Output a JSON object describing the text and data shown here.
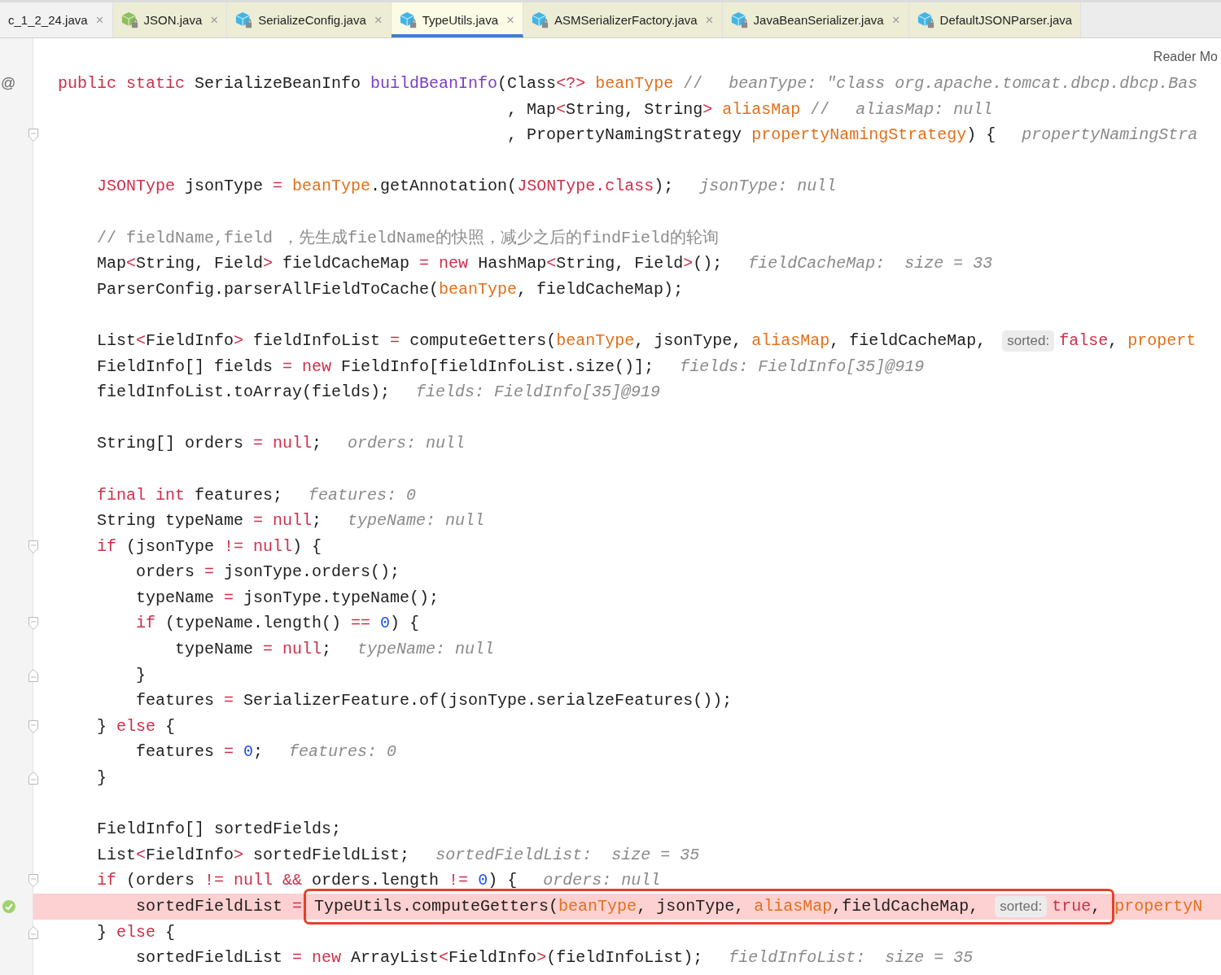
{
  "tabs": [
    {
      "label": "c_1_2_24.java",
      "close": "×",
      "selected": false,
      "library": false
    },
    {
      "label": "JSON.java",
      "close": "×",
      "selected": false,
      "library": true,
      "color": "#8dbf5a"
    },
    {
      "label": "SerializeConfig.java",
      "close": "×",
      "selected": false,
      "library": true,
      "color": "#40b6e8"
    },
    {
      "label": "TypeUtils.java",
      "close": "×",
      "selected": true,
      "library": true,
      "color": "#40b6e8"
    },
    {
      "label": "ASMSerializerFactory.java",
      "close": "×",
      "selected": false,
      "library": true,
      "color": "#40b6e8"
    },
    {
      "label": "JavaBeanSerializer.java",
      "close": "×",
      "selected": false,
      "library": true,
      "color": "#40b6e8"
    },
    {
      "label": "DefaultJSONParser.java",
      "selected": false,
      "library": true,
      "color": "#40b6e8"
    }
  ],
  "reader_mode": "Reader Mo",
  "lines": [
    {
      "kind": "code",
      "highlighted": false,
      "marker": {
        "kind": "text",
        "text": "@"
      },
      "segments": [
        {
          "kind": "code",
          "tokens": [
            {
              "kind": "kw",
              "text": "public static"
            },
            {
              "kind": "p",
              "text": " SerializeBeanInfo "
            },
            {
              "kind": "fn",
              "text": "buildBeanInfo"
            },
            {
              "kind": "p",
              "text": "(Class"
            },
            {
              "kind": "kw",
              "text": "<?>"
            },
            {
              "kind": "param",
              "text": " beanType"
            },
            {
              "kind": "cm",
              "text": " //"
            }
          ]
        },
        {
          "kind": "debug",
          "text": "beanType: \"class org.apache.tomcat.dbcp.dbcp.Bas"
        }
      ]
    },
    {
      "kind": "continuation",
      "highlighted": false,
      "segments": [
        {
          "kind": "code",
          "tokens": [
            {
              "kind": "p",
              "text": ", Map"
            },
            {
              "kind": "kw",
              "text": "<"
            },
            {
              "kind": "p",
              "text": "String, String"
            },
            {
              "kind": "kw",
              "text": ">"
            },
            {
              "kind": "param",
              "text": " aliasMap"
            },
            {
              "kind": "cm",
              "text": " //"
            }
          ]
        },
        {
          "kind": "debug",
          "text": "aliasMap: null"
        }
      ]
    },
    {
      "kind": "continuation",
      "highlighted": false,
      "marker": {
        "kind": "fold-start"
      },
      "segments": [
        {
          "kind": "code",
          "tokens": [
            {
              "kind": "p",
              "text": ", PropertyNamingStrategy "
            },
            {
              "kind": "param",
              "text": "propertyNamingStrategy"
            },
            {
              "kind": "p",
              "text": ") {"
            }
          ]
        },
        {
          "kind": "debug",
          "text": "propertyNamingStra"
        }
      ],
      "children": [
        {
          "kind": "blank",
          "highlighted": false
        },
        {
          "kind": "code",
          "highlighted": false,
          "segments": [
            {
              "kind": "code",
              "tokens": [
                {
                  "kind": "kw",
                  "text": "JSONType"
                },
                {
                  "kind": "p",
                  "text": " jsonType "
                },
                {
                  "kind": "kw",
                  "text": "="
                },
                {
                  "kind": "param",
                  "text": " beanType"
                },
                {
                  "kind": "p",
                  "text": ".getAnnotation("
                },
                {
                  "kind": "kw",
                  "text": "JSONType.class"
                },
                {
                  "kind": "p",
                  "text": ");"
                }
              ]
            },
            {
              "kind": "debug",
              "text": "jsonType: null"
            }
          ]
        },
        {
          "kind": "blank",
          "highlighted": false
        },
        {
          "kind": "code",
          "highlighted": false,
          "segments": [
            {
              "kind": "code",
              "tokens": [
                {
                  "kind": "cm",
                  "text": "// fieldName,field ，先生成fieldName的快照，减少之后的findField的轮询"
                }
              ]
            }
          ]
        },
        {
          "kind": "code",
          "highlighted": false,
          "segments": [
            {
              "kind": "code",
              "tokens": [
                {
                  "kind": "p",
                  "text": "Map"
                },
                {
                  "kind": "kw",
                  "text": "<"
                },
                {
                  "kind": "p",
                  "text": "String, Field"
                },
                {
                  "kind": "kw",
                  "text": ">"
                },
                {
                  "kind": "p",
                  "text": " fieldCacheMap "
                },
                {
                  "kind": "kw",
                  "text": "= new"
                },
                {
                  "kind": "p",
                  "text": " HashMap"
                },
                {
                  "kind": "kw",
                  "text": "<"
                },
                {
                  "kind": "p",
                  "text": "String, Field"
                },
                {
                  "kind": "kw",
                  "text": ">"
                },
                {
                  "kind": "p",
                  "text": "();"
                }
              ]
            },
            {
              "kind": "debug",
              "text": "fieldCacheMap:  size = 33"
            }
          ]
        },
        {
          "kind": "code",
          "highlighted": false,
          "segments": [
            {
              "kind": "code",
              "tokens": [
                {
                  "kind": "p",
                  "text": "ParserConfig.parserAllFieldToCache("
                },
                {
                  "kind": "param",
                  "text": "beanType"
                },
                {
                  "kind": "p",
                  "text": ", fieldCacheMap);"
                }
              ]
            }
          ]
        },
        {
          "kind": "blank",
          "highlighted": false
        },
        {
          "kind": "code",
          "highlighted": false,
          "segments": [
            {
              "kind": "code",
              "tokens": [
                {
                  "kind": "p",
                  "text": "List"
                },
                {
                  "kind": "kw",
                  "text": "<"
                },
                {
                  "kind": "p",
                  "text": "FieldInfo"
                },
                {
                  "kind": "kw",
                  "text": ">"
                },
                {
                  "kind": "p",
                  "text": " fieldInfoList "
                },
                {
                  "kind": "kw",
                  "text": "="
                },
                {
                  "kind": "p",
                  "text": " computeGetters("
                },
                {
                  "kind": "param",
                  "text": "beanType"
                },
                {
                  "kind": "p",
                  "text": ", jsonType, "
                },
                {
                  "kind": "param",
                  "text": "aliasMap"
                },
                {
                  "kind": "p",
                  "text": ", fieldCacheMap,"
                }
              ]
            },
            {
              "kind": "inlay",
              "text": "sorted:"
            },
            {
              "kind": "code",
              "tokens": [
                {
                  "kind": "kw",
                  "text": "false"
                },
                {
                  "kind": "p",
                  "text": ", "
                },
                {
                  "kind": "param",
                  "text": "propert"
                }
              ]
            }
          ]
        },
        {
          "kind": "code",
          "highlighted": false,
          "segments": [
            {
              "kind": "code",
              "tokens": [
                {
                  "kind": "p",
                  "text": "FieldInfo[] fields "
                },
                {
                  "kind": "kw",
                  "text": "= new"
                },
                {
                  "kind": "p",
                  "text": " FieldInfo[fieldInfoList.size()];"
                }
              ]
            },
            {
              "kind": "debug",
              "text": "fields: FieldInfo[35]@919"
            }
          ]
        },
        {
          "kind": "code",
          "highlighted": false,
          "segments": [
            {
              "kind": "code",
              "tokens": [
                {
                  "kind": "p",
                  "text": "fieldInfoList.toArray(fields);"
                }
              ]
            },
            {
              "kind": "debug",
              "text": "fields: FieldInfo[35]@919"
            }
          ]
        },
        {
          "kind": "blank",
          "highlighted": false
        },
        {
          "kind": "code",
          "highlighted": false,
          "segments": [
            {
              "kind": "code",
              "tokens": [
                {
                  "kind": "p",
                  "text": "String[] orders "
                },
                {
                  "kind": "kw",
                  "text": "= null"
                },
                {
                  "kind": "p",
                  "text": ";"
                }
              ]
            },
            {
              "kind": "debug",
              "text": "orders: null"
            }
          ]
        },
        {
          "kind": "blank",
          "highlighted": false
        },
        {
          "kind": "code",
          "highlighted": false,
          "segments": [
            {
              "kind": "code",
              "tokens": [
                {
                  "kind": "kw",
                  "text": "final int"
                },
                {
                  "kind": "p",
                  "text": " features;"
                }
              ]
            },
            {
              "kind": "debug",
              "text": "features: 0"
            }
          ]
        },
        {
          "kind": "code",
          "highlighted": false,
          "segments": [
            {
              "kind": "code",
              "tokens": [
                {
                  "kind": "p",
                  "text": "String typeName "
                },
                {
                  "kind": "kw",
                  "text": "= null"
                },
                {
                  "kind": "p",
                  "text": ";"
                }
              ]
            },
            {
              "kind": "debug",
              "text": "typeName: null"
            }
          ]
        },
        {
          "kind": "code",
          "highlighted": false,
          "marker": {
            "kind": "fold-start"
          },
          "segments": [
            {
              "kind": "code",
              "tokens": [
                {
                  "kind": "kw",
                  "text": "if"
                },
                {
                  "kind": "p",
                  "text": " (jsonType "
                },
                {
                  "kind": "kw",
                  "text": "!= null"
                },
                {
                  "kind": "p",
                  "text": ") {"
                }
              ]
            }
          ],
          "children": [
            {
              "kind": "code",
              "highlighted": false,
              "segments": [
                {
                  "kind": "code",
                  "tokens": [
                    {
                      "kind": "p",
                      "text": "orders "
                    },
                    {
                      "kind": "kw",
                      "text": "="
                    },
                    {
                      "kind": "p",
                      "text": " jsonType.orders();"
                    }
                  ]
                }
              ]
            },
            {
              "kind": "code",
              "highlighted": false,
              "segments": [
                {
                  "kind": "code",
                  "tokens": [
                    {
                      "kind": "p",
                      "text": "typeName "
                    },
                    {
                      "kind": "kw",
                      "text": "="
                    },
                    {
                      "kind": "p",
                      "text": " jsonType.typeName();"
                    }
                  ]
                }
              ]
            },
            {
              "kind": "code",
              "highlighted": false,
              "marker": {
                "kind": "fold-start"
              },
              "segments": [
                {
                  "kind": "code",
                  "tokens": [
                    {
                      "kind": "kw",
                      "text": "if"
                    },
                    {
                      "kind": "p",
                      "text": " (typeName.length() "
                    },
                    {
                      "kind": "kw",
                      "text": "=="
                    },
                    {
                      "kind": "num",
                      "text": " 0"
                    },
                    {
                      "kind": "p",
                      "text": ") {"
                    }
                  ]
                }
              ],
              "children": [
                {
                  "kind": "code",
                  "highlighted": false,
                  "segments": [
                    {
                      "kind": "code",
                      "tokens": [
                        {
                          "kind": "p",
                          "text": "typeName "
                        },
                        {
                          "kind": "kw",
                          "text": "= null"
                        },
                        {
                          "kind": "p",
                          "text": ";"
                        }
                      ]
                    },
                    {
                      "kind": "debug",
                      "text": "typeName: null"
                    }
                  ]
                }
              ]
            },
            {
              "kind": "code",
              "highlighted": false,
              "marker": {
                "kind": "fold-end"
              },
              "segments": [
                {
                  "kind": "code",
                  "tokens": [
                    {
                      "kind": "p",
                      "text": "}"
                    }
                  ]
                }
              ]
            },
            {
              "kind": "code",
              "highlighted": false,
              "segments": [
                {
                  "kind": "code",
                  "tokens": [
                    {
                      "kind": "p",
                      "text": "features "
                    },
                    {
                      "kind": "kw",
                      "text": "="
                    },
                    {
                      "kind": "p",
                      "text": " SerializerFeature.of(jsonType.serialzeFeatures());"
                    }
                  ]
                }
              ]
            }
          ]
        },
        {
          "kind": "code",
          "highlighted": false,
          "marker": {
            "kind": "fold-start"
          },
          "segments": [
            {
              "kind": "code",
              "tokens": [
                {
                  "kind": "p",
                  "text": "} "
                },
                {
                  "kind": "kw",
                  "text": "else"
                },
                {
                  "kind": "p",
                  "text": " {"
                }
              ]
            }
          ],
          "children": [
            {
              "kind": "code",
              "highlighted": false,
              "segments": [
                {
                  "kind": "code",
                  "tokens": [
                    {
                      "kind": "p",
                      "text": "features "
                    },
                    {
                      "kind": "kw",
                      "text": "="
                    },
                    {
                      "kind": "num",
                      "text": " 0"
                    },
                    {
                      "kind": "p",
                      "text": ";"
                    }
                  ]
                },
                {
                  "kind": "debug",
                  "text": "features: 0"
                }
              ]
            }
          ]
        },
        {
          "kind": "code",
          "highlighted": false,
          "marker": {
            "kind": "fold-end"
          },
          "segments": [
            {
              "kind": "code",
              "tokens": [
                {
                  "kind": "p",
                  "text": "}"
                }
              ]
            }
          ]
        },
        {
          "kind": "blank",
          "highlighted": false
        },
        {
          "kind": "code",
          "highlighted": false,
          "segments": [
            {
              "kind": "code",
              "tokens": [
                {
                  "kind": "p",
                  "text": "FieldInfo[] sortedFields;"
                }
              ]
            }
          ]
        },
        {
          "kind": "code",
          "highlighted": false,
          "segments": [
            {
              "kind": "code",
              "tokens": [
                {
                  "kind": "p",
                  "text": "List"
                },
                {
                  "kind": "kw",
                  "text": "<"
                },
                {
                  "kind": "p",
                  "text": "FieldInfo"
                },
                {
                  "kind": "kw",
                  "text": ">"
                },
                {
                  "kind": "p",
                  "text": " sortedFieldList;"
                }
              ]
            },
            {
              "kind": "debug",
              "text": "sortedFieldList:  size = 35"
            }
          ]
        },
        {
          "kind": "code",
          "highlighted": false,
          "marker": {
            "kind": "fold-start"
          },
          "segments": [
            {
              "kind": "code",
              "tokens": [
                {
                  "kind": "kw",
                  "text": "if"
                },
                {
                  "kind": "p",
                  "text": " (orders "
                },
                {
                  "kind": "kw",
                  "text": "!= null &&"
                },
                {
                  "kind": "p",
                  "text": " orders.length "
                },
                {
                  "kind": "kw",
                  "text": "!="
                },
                {
                  "kind": "num",
                  "text": " 0"
                },
                {
                  "kind": "p",
                  "text": ") {"
                }
              ]
            },
            {
              "kind": "debug",
              "text": "orders: null"
            }
          ],
          "children": [
            {
              "kind": "code",
              "highlighted": true,
              "marker": {
                "kind": "ok"
              },
              "segments": [
                {
                  "kind": "code",
                  "tokens": [
                    {
                      "kind": "p",
                      "text": "sortedFieldList "
                    },
                    {
                      "kind": "kw",
                      "text": "="
                    }
                  ]
                },
                {
                  "kind": "frame",
                  "segments": [
                    {
                      "kind": "code",
                      "tokens": [
                        {
                          "kind": "p",
                          "text": "TypeUtils.computeGetters("
                        },
                        {
                          "kind": "param",
                          "text": "beanType"
                        },
                        {
                          "kind": "p",
                          "text": ", jsonType, "
                        },
                        {
                          "kind": "param",
                          "text": "aliasMap"
                        },
                        {
                          "kind": "p",
                          "text": ",fieldCacheMap,"
                        }
                      ]
                    },
                    {
                      "kind": "inlay",
                      "text": "sorted:"
                    },
                    {
                      "kind": "code",
                      "tokens": [
                        {
                          "kind": "kw",
                          "text": "true"
                        },
                        {
                          "kind": "p",
                          "text": ","
                        }
                      ]
                    }
                  ]
                },
                {
                  "kind": "code",
                  "tokens": [
                    {
                      "kind": "param",
                      "text": "propertyN"
                    }
                  ]
                }
              ]
            }
          ]
        },
        {
          "kind": "code",
          "highlighted": false,
          "marker": {
            "kind": "fold-end"
          },
          "segments": [
            {
              "kind": "code",
              "tokens": [
                {
                  "kind": "p",
                  "text": "} "
                },
                {
                  "kind": "kw",
                  "text": "else"
                },
                {
                  "kind": "p",
                  "text": " {"
                }
              ]
            }
          ],
          "children": [
            {
              "kind": "code",
              "highlighted": false,
              "segments": [
                {
                  "kind": "code",
                  "tokens": [
                    {
                      "kind": "p",
                      "text": "sortedFieldList "
                    },
                    {
                      "kind": "kw",
                      "text": "= new"
                    },
                    {
                      "kind": "p",
                      "text": " ArrayList"
                    },
                    {
                      "kind": "kw",
                      "text": "<"
                    },
                    {
                      "kind": "p",
                      "text": "FieldInfo"
                    },
                    {
                      "kind": "kw",
                      "text": ">"
                    },
                    {
                      "kind": "p",
                      "text": "(fieldInfoList);"
                    }
                  ]
                },
                {
                  "kind": "debug",
                  "text": "fieldInfoList:  size = 35"
                }
              ]
            }
          ]
        }
      ]
    }
  ]
}
